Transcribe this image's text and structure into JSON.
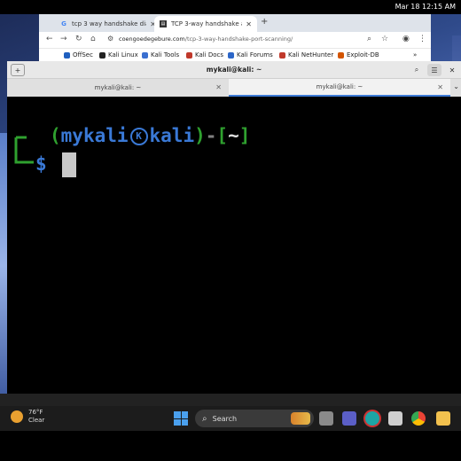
{
  "status_bar": {
    "datetime": "Mar 18  12:15 AM"
  },
  "browser": {
    "tabs": [
      {
        "label": "tcp 3 way handshake dia",
        "icon": "google-icon",
        "active": false
      },
      {
        "label": "TCP 3-way handshake a",
        "icon": "page-icon",
        "active": true
      }
    ],
    "new_tab": "+",
    "url_domain": "coengoedegebure.com",
    "url_path": "/tcp-3-way-handshake-port-scanning/",
    "bookmarks": [
      {
        "label": "OffSec",
        "color": "#1f5fbf"
      },
      {
        "label": "Kali Linux",
        "color": "#222222"
      },
      {
        "label": "Kali Tools",
        "color": "#3a6fd0"
      },
      {
        "label": "Kali Docs",
        "color": "#c0392b"
      },
      {
        "label": "Kali Forums",
        "color": "#2c66c8"
      },
      {
        "label": "Kali NetHunter",
        "color": "#c0392b"
      },
      {
        "label": "Exploit-DB",
        "color": "#d35400"
      }
    ],
    "more_bookmarks": "»"
  },
  "terminal": {
    "title": "mykali@kali: ~",
    "tabs": [
      {
        "label": "mykali@kali: ~",
        "active": false
      },
      {
        "label": "mykali@kali: ~",
        "active": true
      }
    ],
    "prompt": {
      "open": "(",
      "user": "mykali",
      "host": "kali",
      "close": ")",
      "dash": "-",
      "dir_open": "[",
      "dir": "~",
      "dir_close": "]",
      "symbol": "$"
    }
  },
  "taskbar": {
    "weather_temp": "76°F",
    "weather_cond": "Clear",
    "search_label": "Search"
  },
  "colors": {
    "prompt_green": "#2fa12f",
    "prompt_blue": "#3a79d6",
    "tab_accent": "#3e7bd6"
  }
}
